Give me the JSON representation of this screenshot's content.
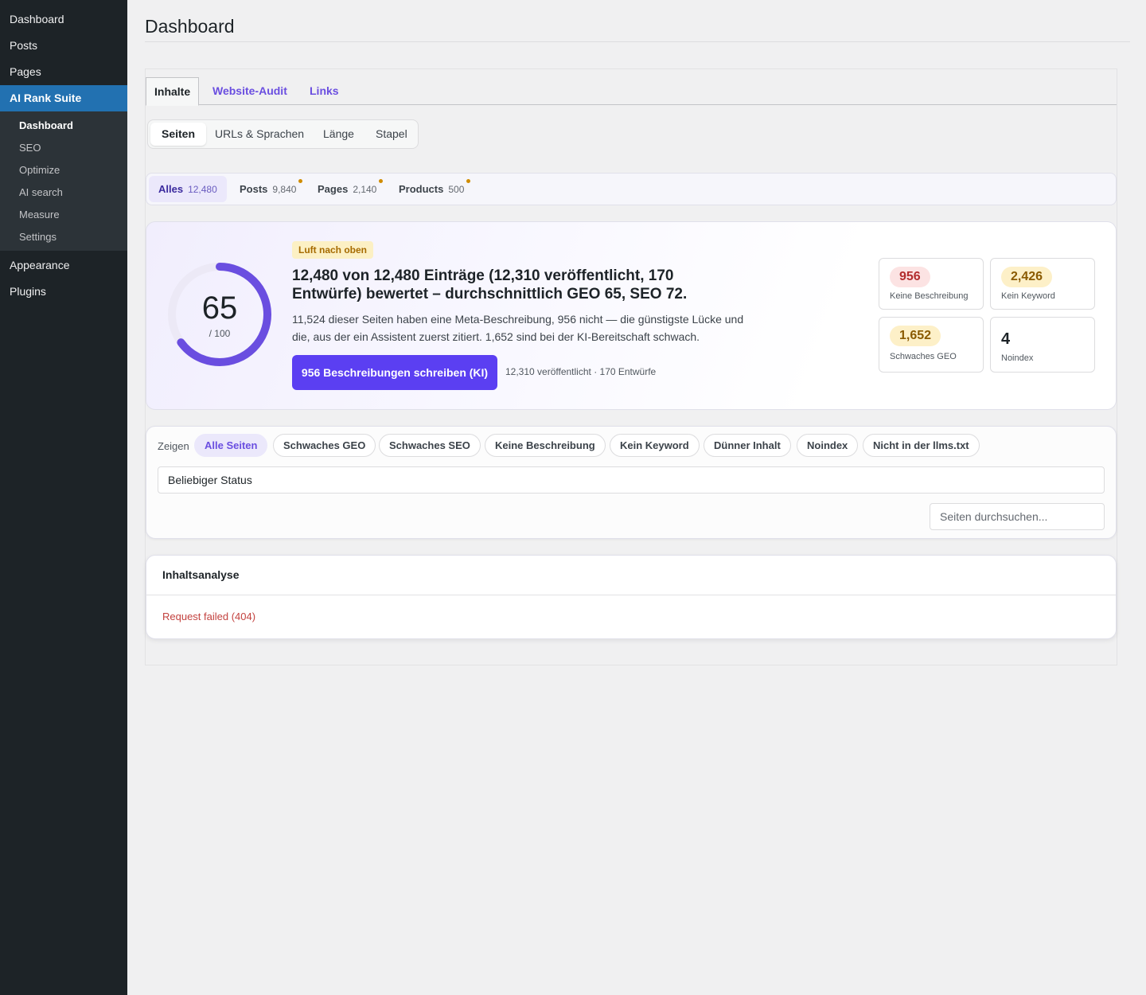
{
  "sidebar": {
    "items_top": [
      {
        "label": "Dashboard"
      },
      {
        "label": "Posts"
      },
      {
        "label": "Pages"
      }
    ],
    "active": {
      "label": "AI Rank Suite"
    },
    "submenu": [
      {
        "label": "Dashboard",
        "current": true
      },
      {
        "label": "SEO"
      },
      {
        "label": "Optimize"
      },
      {
        "label": "AI search"
      },
      {
        "label": "Measure"
      },
      {
        "label": "Settings"
      }
    ],
    "items_bottom": [
      {
        "label": "Appearance"
      },
      {
        "label": "Plugins"
      }
    ]
  },
  "page": {
    "title": "Dashboard"
  },
  "tabs": [
    {
      "label": "Inhalte",
      "active": true
    },
    {
      "label": "Website-Audit"
    },
    {
      "label": "Links"
    }
  ],
  "segments": [
    {
      "label": "Seiten",
      "active": true
    },
    {
      "label": "URLs & Sprachen"
    },
    {
      "label": "Länge"
    },
    {
      "label": "Stapel"
    }
  ],
  "types": [
    {
      "label": "Alles",
      "count": "12,480",
      "active": true
    },
    {
      "label": "Posts",
      "count": "9,840",
      "dot": true
    },
    {
      "label": "Pages",
      "count": "2,140",
      "dot": true
    },
    {
      "label": "Products",
      "count": "500",
      "dot": true
    }
  ],
  "hero": {
    "score": 65,
    "score_fraction": 0.65,
    "score_max": "/ 100",
    "badge": "Luft nach oben",
    "title": "12,480 von 12,480 Einträge (12,310 veröffentlicht, 170 Entwürfe) bewertet – durchschnittlich GEO 65, SEO 72.",
    "text": "11,524 dieser Seiten haben eine Meta-Beschreibung, 956 nicht — die günstigste Lücke und die, aus der ein Assistent zuerst zitiert. 1,652 sind bei der KI-Bereitschaft schwach.",
    "cta": "956 Beschreibungen schreiben (KI)",
    "meta": "12,310 veröffentlicht · 170 Entwürfe",
    "accent": "#6a4ee0"
  },
  "stats": [
    {
      "value": "956",
      "label": "Keine Beschreibung",
      "tone": "red"
    },
    {
      "value": "2,426",
      "label": "Kein Keyword",
      "tone": "amber"
    },
    {
      "value": "1,652",
      "label": "Schwaches GEO",
      "tone": "amber"
    },
    {
      "value": "4",
      "label": "Noindex",
      "tone": "plain"
    }
  ],
  "filters": {
    "show_label": "Zeigen",
    "chips": [
      {
        "label": "Alle Seiten",
        "active": true
      },
      {
        "label": "Schwaches GEO"
      },
      {
        "label": "Schwaches SEO"
      },
      {
        "label": "Keine Beschreibung"
      },
      {
        "label": "Kein Keyword"
      },
      {
        "label": "Dünner Inhalt"
      },
      {
        "label": "Noindex"
      },
      {
        "label": "Nicht in der llms.txt"
      }
    ],
    "status_value": "Beliebiger Status",
    "search_placeholder": "Seiten durchsuchen..."
  },
  "analysis": {
    "title": "Inhaltsanalyse",
    "error": "Request failed (404)"
  }
}
